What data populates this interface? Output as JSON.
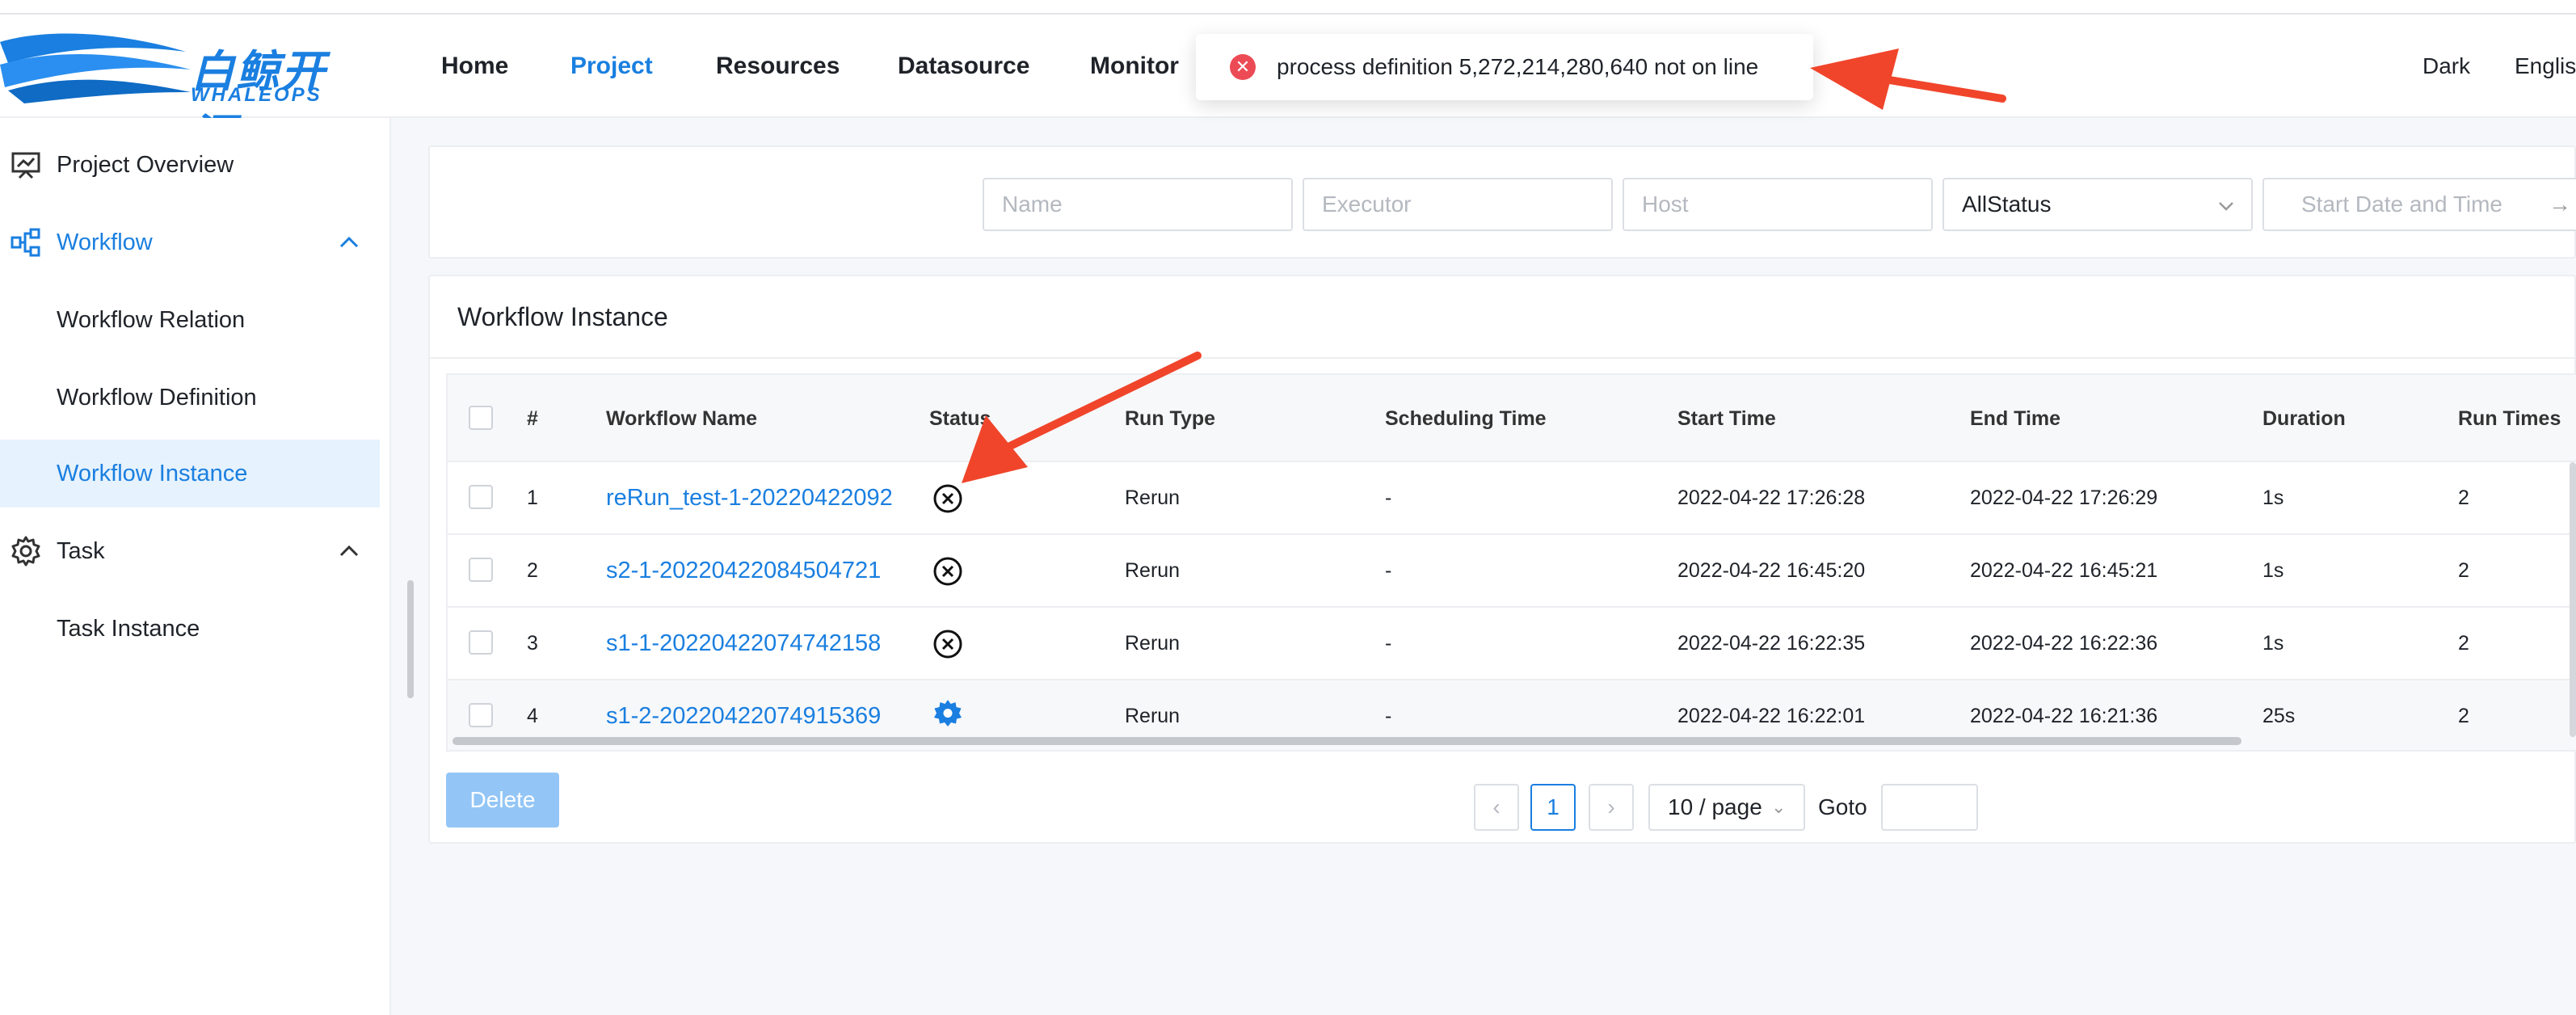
{
  "brand": {
    "name_cn": "白鲸开源",
    "name_en": "WHALEOPS"
  },
  "nav": [
    {
      "label": "Home",
      "active": false
    },
    {
      "label": "Project",
      "active": true
    },
    {
      "label": "Resources",
      "active": false
    },
    {
      "label": "Datasource",
      "active": false
    },
    {
      "label": "Monitor",
      "active": false
    }
  ],
  "header_right": {
    "theme": "Dark",
    "language": "Englis"
  },
  "toast": {
    "icon": "error-icon",
    "message": "process definition 5,272,214,280,640 not on line"
  },
  "sidebar": {
    "items": [
      {
        "label": "Project Overview",
        "icon": "presentation-chart-icon"
      },
      {
        "label": "Workflow",
        "icon": "flow-icon",
        "expanded": true
      },
      {
        "label": "Workflow Relation"
      },
      {
        "label": "Workflow Definition"
      },
      {
        "label": "Workflow Instance",
        "selected": true
      },
      {
        "label": "Task",
        "icon": "gear-icon",
        "expanded": true
      },
      {
        "label": "Task Instance"
      }
    ]
  },
  "filters": {
    "name_placeholder": "Name",
    "executor_placeholder": "Executor",
    "host_placeholder": "Host",
    "status_value": "AllStatus",
    "start_date_placeholder": "Start Date and Time"
  },
  "card": {
    "title": "Workflow Instance"
  },
  "table": {
    "columns": [
      "#",
      "Workflow Name",
      "Status",
      "Run Type",
      "Scheduling Time",
      "Start Time",
      "End Time",
      "Duration",
      "Run Times"
    ],
    "rows": [
      {
        "idx": "1",
        "name": "reRun_test-1-20220422092",
        "status": "failed-icon",
        "run_type": "Rerun",
        "scheduling_time": "-",
        "start_time": "2022-04-22 17:26:28",
        "end_time": "2022-04-22 17:26:29",
        "duration": "1s",
        "run_times": "2"
      },
      {
        "idx": "2",
        "name": "s2-1-20220422084504721",
        "status": "failed-icon",
        "run_type": "Rerun",
        "scheduling_time": "-",
        "start_time": "2022-04-22 16:45:20",
        "end_time": "2022-04-22 16:45:21",
        "duration": "1s",
        "run_times": "2"
      },
      {
        "idx": "3",
        "name": "s1-1-20220422074742158",
        "status": "failed-icon",
        "run_type": "Rerun",
        "scheduling_time": "-",
        "start_time": "2022-04-22 16:22:35",
        "end_time": "2022-04-22 16:22:36",
        "duration": "1s",
        "run_times": "2"
      },
      {
        "idx": "4",
        "name": "s1-2-20220422074915369",
        "status": "running-gear-icon",
        "run_type": "Rerun",
        "scheduling_time": "-",
        "start_time": "2022-04-22 16:22:01",
        "end_time": "2022-04-22 16:21:36",
        "duration": "25s",
        "run_times": "2"
      }
    ]
  },
  "actions": {
    "delete_label": "Delete"
  },
  "pagination": {
    "current_page": "1",
    "page_size": "10 / page",
    "goto_label": "Goto"
  },
  "colors": {
    "accent": "#1a7fe0",
    "error": "#ec4b55",
    "annotation_arrow": "#f0452b"
  }
}
